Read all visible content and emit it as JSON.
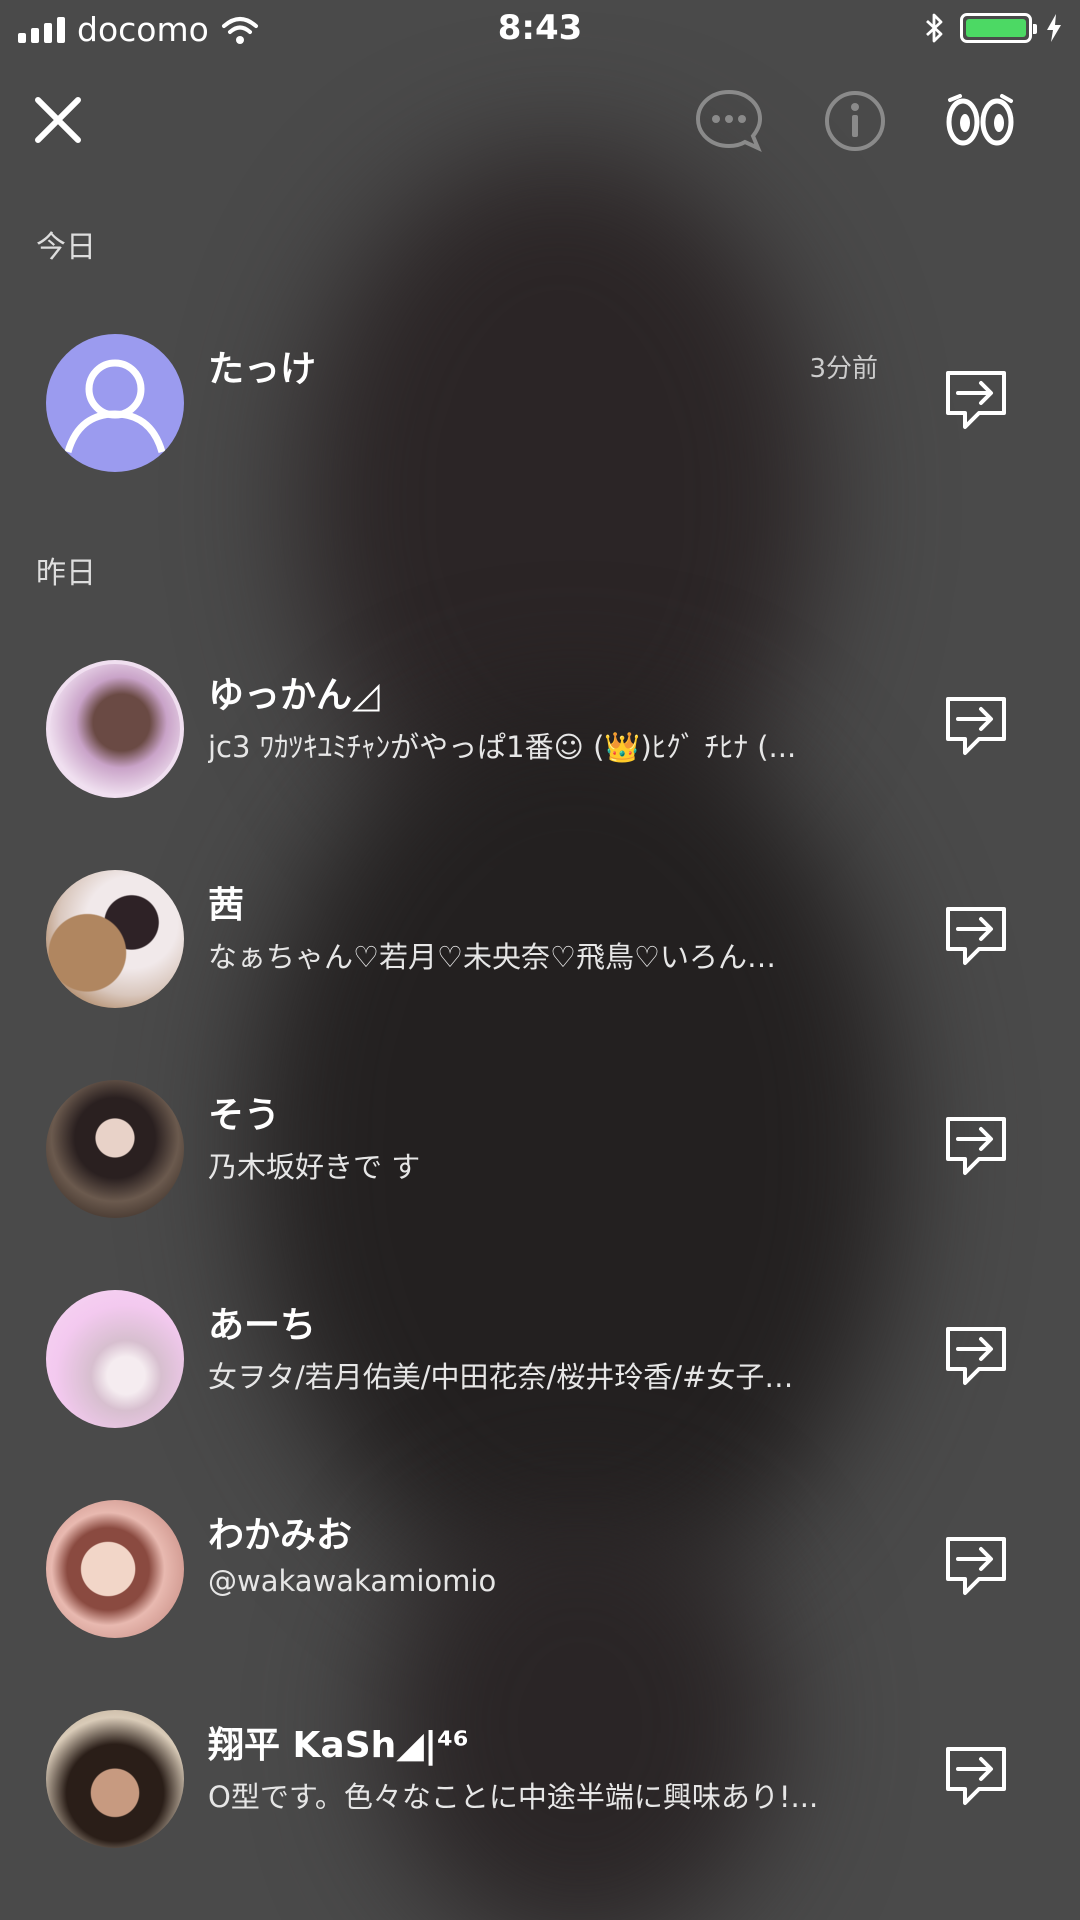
{
  "status_bar": {
    "carrier": "docomo",
    "time": "8:43",
    "battery_color": "#4cd964"
  },
  "toolbar": {
    "icons": [
      "close-icon",
      "chat-bubble-icon",
      "info-icon",
      "eyes-icon"
    ]
  },
  "sections": [
    {
      "label": "今日",
      "users": [
        {
          "name": "たっけ",
          "subtitle": "",
          "time": "3分前",
          "avatar": "default-user"
        }
      ]
    },
    {
      "label": "昨日",
      "users": [
        {
          "name": "ゆっかん◿",
          "subtitle": "jc3 ﾜｶﾂｷﾕﾐﾁｬﾝがやっぱ1番☺ (👑)ﾋｸﾞ ﾁﾋﾅ (...",
          "time": "",
          "avatar": "photo"
        },
        {
          "name": "茜",
          "subtitle": "なぁちゃん♡若月♡未央奈♡飛鳥♡いろん…",
          "time": "",
          "avatar": "photo"
        },
        {
          "name": "そう",
          "subtitle": "乃木坂好きで す",
          "time": "",
          "avatar": "photo"
        },
        {
          "name": "あーち",
          "subtitle": "女ヲタ/若月佑美/中田花奈/桜井玲香/#女子…",
          "time": "",
          "avatar": "photo"
        },
        {
          "name": "わかみお",
          "subtitle": "@wakawakamiomio",
          "time": "",
          "avatar": "photo"
        },
        {
          "name": "翔平 KaSh◢|⁴⁶",
          "subtitle": "O型です。色々なことに中途半端に興味あり!...",
          "time": "",
          "avatar": "photo"
        }
      ]
    }
  ]
}
